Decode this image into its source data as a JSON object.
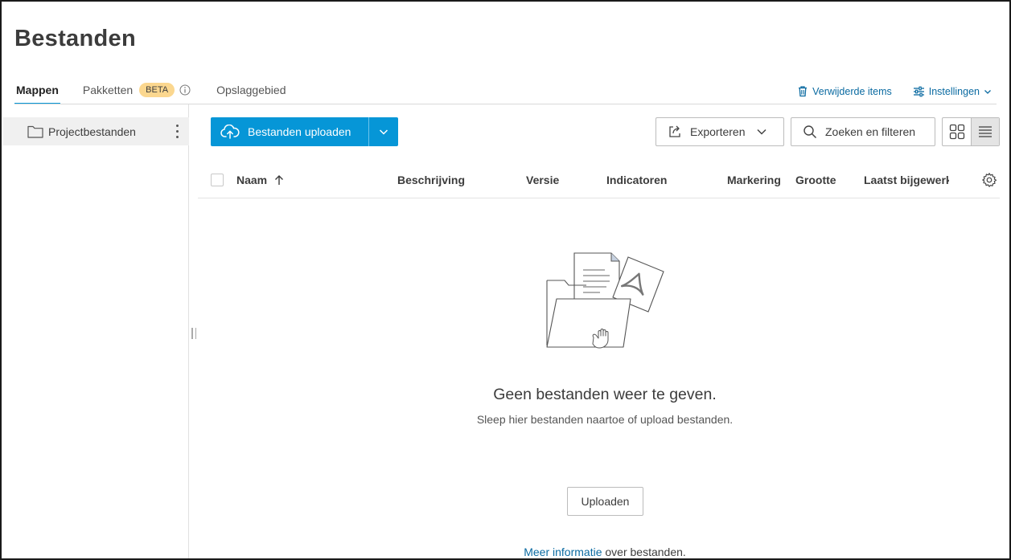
{
  "page": {
    "title": "Bestanden"
  },
  "tabs": [
    {
      "label": "Mappen",
      "active": true
    },
    {
      "label": "Pakketten",
      "badge": "BETA"
    },
    {
      "label": "Opslaggebied"
    }
  ],
  "top_actions": {
    "deleted_items": "Verwijderde items",
    "settings": "Instellingen"
  },
  "sidebar": {
    "items": [
      {
        "label": "Projectbestanden",
        "icon": "folder-icon"
      }
    ]
  },
  "toolbar": {
    "upload_label": "Bestanden uploaden",
    "export_label": "Exporteren",
    "search_label": "Zoeken en filteren"
  },
  "table": {
    "columns": [
      "Naam",
      "Beschrijving",
      "Versie",
      "Indicatoren",
      "Markering",
      "Grootte",
      "Laatst bijgewerkt"
    ]
  },
  "empty_state": {
    "title": "Geen bestanden weer te geven.",
    "subtitle": "Sleep hier bestanden naartoe of upload bestanden.",
    "upload_button": "Uploaden",
    "more_info_link": "Meer informatie",
    "more_info_suffix": " over bestanden."
  },
  "colors": {
    "accent": "#0696d7",
    "link": "#0a6aa1",
    "beta_badge": "#fbd78f"
  }
}
